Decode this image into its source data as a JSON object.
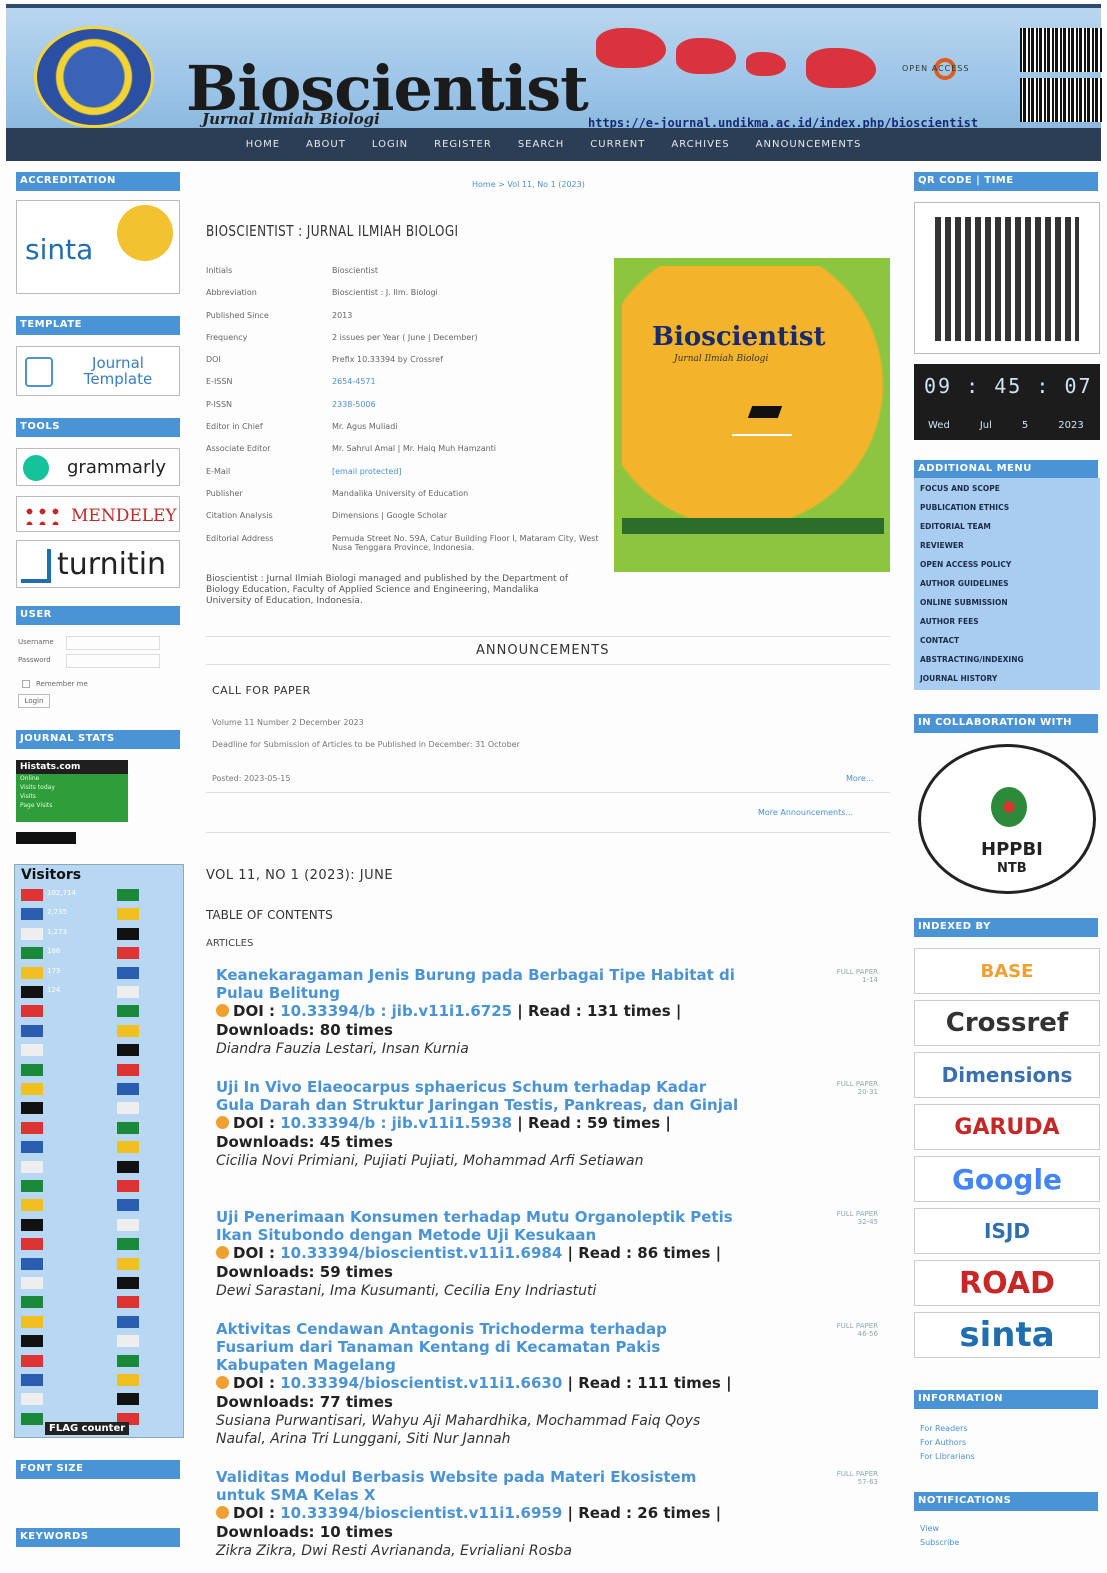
{
  "header": {
    "title": "Bioscientist",
    "subtitle": "Jurnal Ilmiah Biologi",
    "url": "https://e-journal.undikma.ac.id/index.php/bioscientist",
    "open_access": "OPEN ACCESS"
  },
  "nav": [
    "HOME",
    "ABOUT",
    "LOGIN",
    "REGISTER",
    "SEARCH",
    "CURRENT",
    "ARCHIVES",
    "ANNOUNCEMENTS"
  ],
  "left": {
    "accreditation": "ACCREDITATION",
    "sinta": "sinta",
    "template": "TEMPLATE",
    "journal_template": "Journal Template",
    "tools": "TOOLS",
    "grammarly": "grammarly",
    "mendeley": "MENDELEY",
    "turnitin": "turnitin",
    "user": "USER",
    "username": "Username",
    "password": "Password",
    "remember": "Remember me",
    "login": "Login",
    "stats": "JOURNAL STATS",
    "histats": "Histats.com",
    "stats_lines": [
      "Online",
      "Visits today",
      "Visits",
      "Page Visits"
    ],
    "visitors": "Visitors",
    "flag_counter": "FLAG counter",
    "font_size": "FONT SIZE",
    "keywords": "KEYWORDS",
    "visitor_counts": [
      "102,714",
      "2,735",
      "1,273",
      "186",
      "173",
      "124"
    ]
  },
  "breadcrumb": "Home > Vol 11, No 1 (2023)",
  "journal_title": "BIOSCIENTIST : JURNAL ILMIAH BIOLOGI",
  "info": [
    {
      "k": "Initials",
      "v": "Bioscientist",
      "link": false
    },
    {
      "k": "Abbreviation",
      "v": "Bioscientist : J. Ilm. Biologi",
      "link": false
    },
    {
      "k": "Published Since",
      "v": "2013",
      "link": false
    },
    {
      "k": "Frequency",
      "v": "2 issues per Year ( June | December)",
      "link": false
    },
    {
      "k": "DOI",
      "v": "Prefix 10.33394 by Crossref",
      "link": false
    },
    {
      "k": "E-ISSN",
      "v": "2654-4571",
      "link": true
    },
    {
      "k": "P-ISSN",
      "v": "2338-5006",
      "link": true
    },
    {
      "k": "Editor in Chief",
      "v": "Mr. Agus Muliadi",
      "link": false
    },
    {
      "k": "Associate Editor",
      "v": "Mr. Sahrul Amal | Mr. Haiq Muh Hamzanti",
      "link": false
    },
    {
      "k": "E-Mail",
      "v": "[email protected]",
      "link": true
    },
    {
      "k": "Publisher",
      "v": "Mandalika University of Education",
      "link": false
    },
    {
      "k": "Citation Analysis",
      "v": "Dimensions | Google Scholar",
      "link": false
    },
    {
      "k": "Editorial Address",
      "v": "Pemuda Street No. 59A, Catur Building Floor I, Mataram City, West Nusa Tenggara Province, Indonesia.",
      "link": false
    }
  ],
  "cover": {
    "title": "Bioscientist",
    "subtitle": "Jurnal Ilmiah Biologi"
  },
  "description": "Bioscientist : Jurnal Ilmiah Biologi managed and published by the Department of Biology Education, Faculty of Applied Science and Engineering, Mandalika University of Education, Indonesia.",
  "announcements": {
    "heading": "ANNOUNCEMENTS",
    "title": "CALL FOR PAPER",
    "line1": "Volume 11 Number 2 December 2023",
    "line2": "Deadline for Submission of Articles to be Published in December: 31 October",
    "posted": "Posted: 2023-05-15",
    "more": "More...",
    "more_ann": "More Announcements..."
  },
  "issue": {
    "vol": "VOL 11, NO 1 (2023): JUNE",
    "toc": "TABLE OF CONTENTS",
    "articles": "ARTICLES"
  },
  "articles": [
    {
      "title": "Keanekaragaman Jenis Burung pada Berbagai Tipe Habitat di Pulau Belitung",
      "doi": "10.33394/b : jib.v11i1.6725",
      "read": "131",
      "downloads": "80",
      "authors": "Diandra Fauzia Lestari, Insan Kurnia",
      "pages": "1-14"
    },
    {
      "title": "Uji In Vivo Elaeocarpus sphaericus Schum terhadap Kadar Gula Darah dan Struktur Jaringan Testis, Pankreas, dan Ginjal",
      "doi": "10.33394/b : jib.v11i1.5938",
      "read": "59",
      "downloads": "45",
      "authors": "Cicilia Novi Primiani, Pujiati Pujiati, Mohammad Arfi Setiawan",
      "pages": "20-31"
    },
    {
      "title": "Uji Penerimaan Konsumen terhadap Mutu Organoleptik Petis Ikan Situbondo dengan Metode Uji Kesukaan",
      "doi": "10.33394/bioscientist.v11i1.6984",
      "read": "86",
      "downloads": "59",
      "authors": "Dewi Sarastani, Ima Kusumanti, Cecilia Eny Indriastuti",
      "pages": "32-45"
    },
    {
      "title": "Aktivitas Cendawan Antagonis Trichoderma terhadap Fusarium dari Tanaman Kentang di Kecamatan Pakis Kabupaten Magelang",
      "doi": "10.33394/bioscientist.v11i1.6630",
      "read": "111",
      "downloads": "77",
      "authors": "Susiana Purwantisari, Wahyu Aji Mahardhika, Mochammad Faiq Qoys Naufal, Arina Tri Lunggani, Siti Nur Jannah",
      "pages": "46-56"
    },
    {
      "title": "Validitas Modul Berbasis Website pada Materi Ekosistem untuk SMA Kelas X",
      "doi": "10.33394/bioscientist.v11i1.6959",
      "read": "26",
      "downloads": "10",
      "authors": "Zikra Zikra, Dwi Resti Avriananda, Evrialiani Rosba",
      "pages": "57-63"
    }
  ],
  "labels": {
    "doi": "DOI :",
    "read": "Read :",
    "times": "times",
    "downloads": "Downloads:",
    "full": "FULL PAPER"
  },
  "right": {
    "qr": "QR CODE | TIME",
    "clock": {
      "h": "09",
      "m": "45",
      "s": "07",
      "day": "Wed",
      "mon": "Jul",
      "date": "5",
      "year": "2023"
    },
    "additional": "ADDITIONAL MENU",
    "menu": [
      "FOCUS AND SCOPE",
      "PUBLICATION ETHICS",
      "EDITORIAL TEAM",
      "REVIEWER",
      "OPEN ACCESS POLICY",
      "AUTHOR GUIDELINES",
      "ONLINE SUBMISSION",
      "AUTHOR FEES",
      "CONTACT",
      "ABSTRACTING/INDEXING",
      "JOURNAL HISTORY"
    ],
    "collab": "IN COLLABORATION WITH",
    "hppbi": "HPPBI",
    "ntb": "NTB",
    "indexed": "INDEXED BY",
    "indexers": [
      "BASE",
      "Crossref",
      "Dimensions",
      "GARUDA",
      "Google",
      "ISJD",
      "ROAD",
      "sinta"
    ],
    "information": "INFORMATION",
    "info_links": [
      "For Readers",
      "For Authors",
      "For Librarians"
    ],
    "notifications": "NOTIFICATIONS",
    "notif_links": [
      "View",
      "Subscribe"
    ]
  },
  "colors": {
    "accent": "#4a93d4",
    "nav": "#2c3e56"
  }
}
